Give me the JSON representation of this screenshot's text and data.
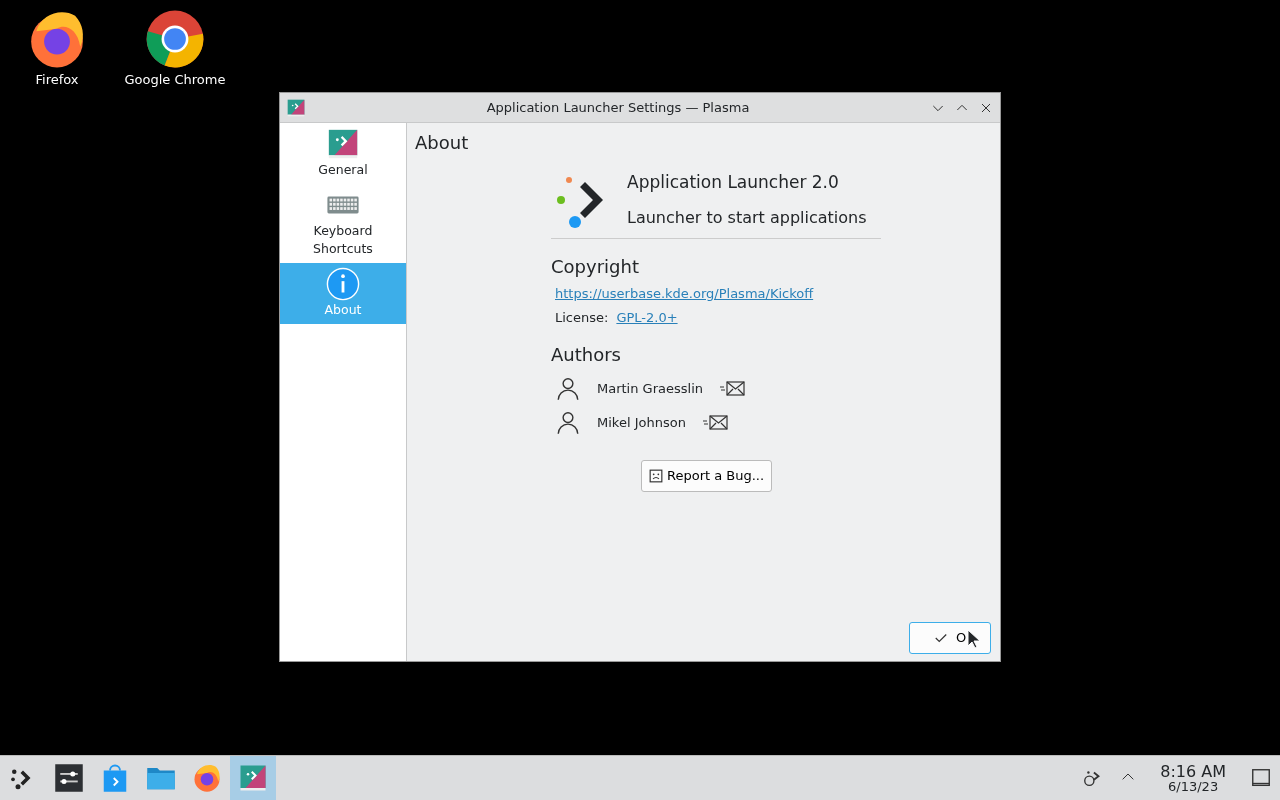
{
  "desktop_icons": [
    {
      "label": "Firefox",
      "kind": "firefox"
    },
    {
      "label": "Google Chrome",
      "kind": "chrome"
    }
  ],
  "window": {
    "title": "Application Launcher Settings — Plasma",
    "sidebar": [
      {
        "label": "General",
        "kind": "launcher",
        "selected": false
      },
      {
        "label": "Keyboard Shortcuts",
        "kind": "keyboard",
        "selected": false
      },
      {
        "label": "About",
        "kind": "info",
        "selected": true
      }
    ],
    "page_title": "About",
    "app": {
      "name": "Application Launcher 2.0",
      "description": "Launcher to start applications"
    },
    "copyright": {
      "heading": "Copyright",
      "url": "https://userbase.kde.org/Plasma/Kickoff",
      "license_label": "License:",
      "license": "GPL-2.0+"
    },
    "authors": {
      "heading": "Authors",
      "people": [
        {
          "name": "Martin Graesslin"
        },
        {
          "name": "Mikel Johnson"
        }
      ]
    },
    "report_button": "Report a Bug...",
    "ok_button": "O"
  },
  "taskbar": {
    "items": [
      {
        "kind": "launcher",
        "selected": false
      },
      {
        "kind": "settings",
        "selected": false
      },
      {
        "kind": "store",
        "selected": false
      },
      {
        "kind": "folder",
        "selected": false
      },
      {
        "kind": "firefox",
        "selected": false
      },
      {
        "kind": "app",
        "selected": true
      }
    ],
    "time": "8:16 AM",
    "date": "6/13/23"
  }
}
